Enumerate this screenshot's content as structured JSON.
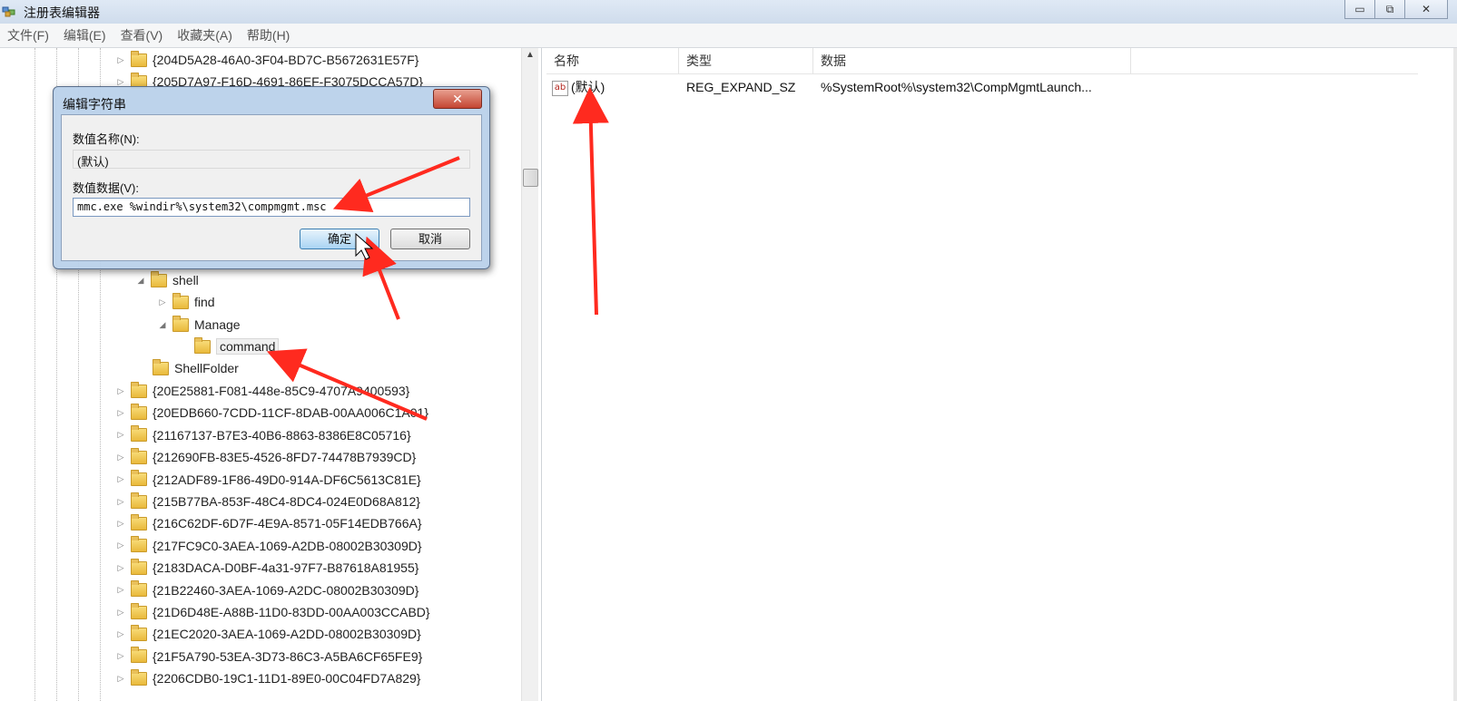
{
  "window": {
    "title": "注册表编辑器",
    "controls": {
      "minimize": "▭",
      "restore": "⧉",
      "close": "✕"
    }
  },
  "menu": [
    "文件(F)",
    "编辑(E)",
    "查看(V)",
    "收藏夹(A)",
    "帮助(H)"
  ],
  "tree": {
    "top_items": [
      {
        "label": "{204D5A28-46A0-3F04-BD7C-B5672631E57F}"
      },
      {
        "label": "{205D7A97-F16D-4691-86EF-F3075DCCA57D}"
      }
    ],
    "shell_subtree": [
      {
        "label": "shell",
        "expander": "◢",
        "level": 0
      },
      {
        "label": "find",
        "expander": "▷",
        "level": 1
      },
      {
        "label": "Manage",
        "expander": "◢",
        "level": 1
      },
      {
        "label": "command",
        "expander": "",
        "level": 2,
        "selected": true
      },
      {
        "label": "ShellFolder",
        "expander": "",
        "level": 0
      }
    ],
    "bottom_items": [
      "{20E25881-F081-448e-85C9-4707A9400593}",
      "{20EDB660-7CDD-11CF-8DAB-00AA006C1A01}",
      "{21167137-B7E3-40B6-8863-8386E8C05716}",
      "{212690FB-83E5-4526-8FD7-74478B7939CD}",
      "{212ADF89-1F86-49D0-914A-DF6C5613C81E}",
      "{215B77BA-853F-48C4-8DC4-024E0D68A812}",
      "{216C62DF-6D7F-4E9A-8571-05F14EDB766A}",
      "{217FC9C0-3AEA-1069-A2DB-08002B30309D}",
      "{2183DACA-D0BF-4a31-97F7-B87618A81955}",
      "{21B22460-3AEA-1069-A2DC-08002B30309D}",
      "{21D6D48E-A88B-11D0-83DD-00AA003CCABD}",
      "{21EC2020-3AEA-1069-A2DD-08002B30309D}",
      "{21F5A790-53EA-3D73-86C3-A5BA6CF65FE9}",
      "{2206CDB0-19C1-11D1-89E0-00C04FD7A829}"
    ]
  },
  "list": {
    "headers": {
      "name": "名称",
      "type": "类型",
      "data": "数据"
    },
    "rows": [
      {
        "icon": "ab",
        "name": "(默认)",
        "type": "REG_EXPAND_SZ",
        "data": "%SystemRoot%\\system32\\CompMgmtLaunch..."
      }
    ]
  },
  "dialog": {
    "title": "编辑字符串",
    "close_label": "✕",
    "name_label": "数值名称(N):",
    "name_value": "(默认)",
    "data_label": "数值数据(V):",
    "data_value": "mmc.exe %windir%\\system32\\compmgmt.msc",
    "ok_label": "确定",
    "cancel_label": "取消"
  },
  "colors": {
    "annotation_arrow": "#ff2a1f",
    "title_bar": "#dbe6f3"
  }
}
